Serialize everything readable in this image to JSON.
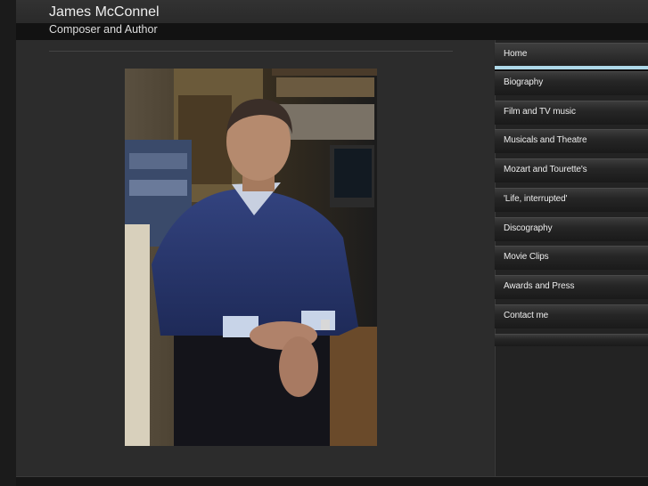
{
  "header": {
    "title": "James McConnel",
    "subtitle": "Composer and Author"
  },
  "main": {
    "photo": {
      "subject": "portrait-photo",
      "colors": {
        "sweater": "#2b3a75",
        "background": "#3a3020",
        "skin": "#b58a6e"
      }
    }
  },
  "sidebar": {
    "accent": "#aed8e8",
    "items": [
      {
        "label": "Home",
        "active": true
      },
      {
        "label": "Biography"
      },
      {
        "label": "Film and TV music"
      },
      {
        "label": "Musicals and Theatre"
      },
      {
        "label": "Mozart and Tourette's"
      },
      {
        "label": "'Life, interrupted'"
      },
      {
        "label": "Discography"
      },
      {
        "label": "Movie Clips"
      },
      {
        "label": "Awards and Press"
      },
      {
        "label": "Contact me"
      }
    ]
  }
}
